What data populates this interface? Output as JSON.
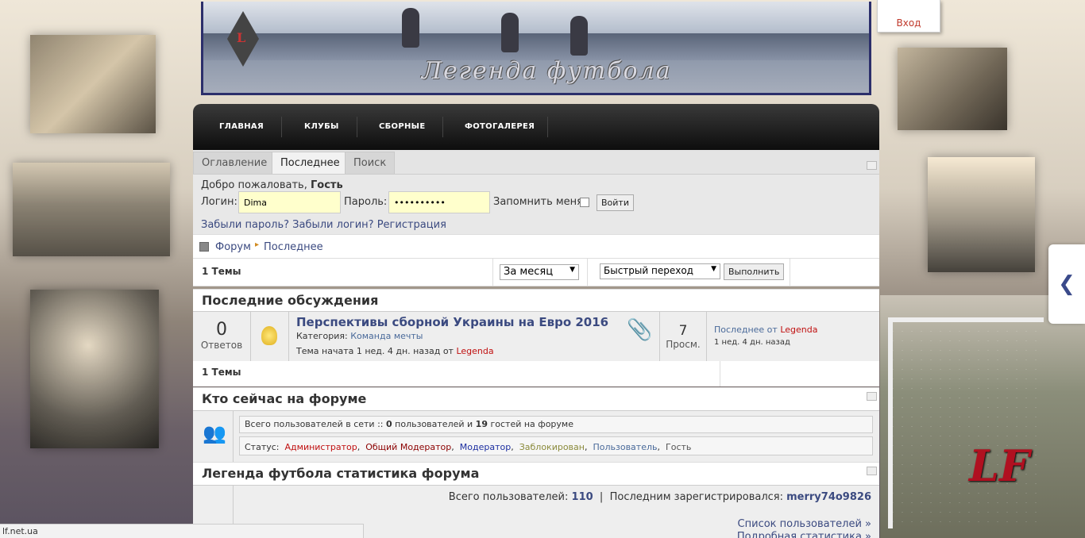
{
  "header": {
    "login_link": "Вход",
    "site_title": "Легенда футбола",
    "badge_letter": "L"
  },
  "nav": {
    "items": [
      "ГЛАВНАЯ",
      "КЛУБЫ",
      "СБОРНЫЕ",
      "ФОТОГАЛЕРЕЯ"
    ]
  },
  "tabs": [
    "Оглавление",
    "Последнее",
    "Поиск"
  ],
  "login": {
    "welcome": "Добро пожаловать,",
    "guest": "Гость",
    "login_label": "Логин:",
    "login_value": "Dima",
    "password_label": "Пароль:",
    "password_value": "••••••••••",
    "remember": "Запомнить меня",
    "submit": "Войти",
    "forgot_password": "Забыли пароль?",
    "forgot_login": "Забыли логин?",
    "register": "Регистрация"
  },
  "breadcrumb": {
    "forum": "Форум",
    "current": "Последнее"
  },
  "toolbar": {
    "topics_count": "1 Темы",
    "period": "За месяц",
    "quick_jump": "Быстрый переход",
    "go": "Выполнить"
  },
  "latest": {
    "heading": "Последние обсуждения",
    "topic": {
      "replies": "0",
      "replies_label": "Ответов",
      "title": "Перспективы сборной Украины на Евро 2016",
      "category_label": "Категория:",
      "category": "Команда мечты",
      "started": "Тема начата 1 нед. 4 дн. назад",
      "started_by": "от",
      "author": "Legenda",
      "views": "7",
      "views_label": "Просм.",
      "last_label": "Последнее от",
      "last_author": "Legenda",
      "last_time": "1 нед. 4 дн. назад"
    },
    "footer_count": "1 Темы"
  },
  "who": {
    "heading": "Кто сейчас на форуме",
    "total_prefix": "Всего пользователей в сети ::",
    "users_count": "0",
    "users_label": "пользователей и",
    "guests_count": "19",
    "guests_label": "гостей на форуме",
    "status_label": "Статус:",
    "statuses": [
      "Администратор",
      "Общий Модератор",
      "Модератор",
      "Заблокирован",
      "Пользователь",
      "Гость"
    ]
  },
  "stats": {
    "heading": "Легенда футбола статистика форума",
    "total_users_label": "Всего пользователей:",
    "total_users": "110",
    "last_registered_label": "Последним зарегистрировался:",
    "last_registered": "merry74o9826",
    "user_list_link": "Список пользователей »",
    "detailed_link": "Подробная статистика »"
  },
  "status_bar": "lf.net.ua",
  "logo_mark": "LF",
  "colors": {
    "accent_red": "#c01010",
    "link_blue": "#3b4a80",
    "nav_dark": "#0d0d0d"
  }
}
